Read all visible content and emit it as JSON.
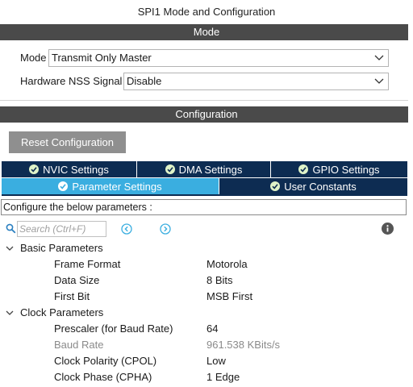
{
  "window": {
    "title": "SPI1 Mode and Configuration"
  },
  "mode_section": {
    "header": "Mode",
    "fields": [
      {
        "label": "Mode",
        "value": "Transmit Only Master"
      },
      {
        "label": "Hardware NSS Signal",
        "value": "Disable"
      }
    ]
  },
  "config_section": {
    "header": "Configuration",
    "reset_label": "Reset Configuration",
    "tabs_row1": [
      {
        "label": "NVIC Settings"
      },
      {
        "label": "DMA Settings"
      },
      {
        "label": "GPIO Settings"
      }
    ],
    "tabs_row2": [
      {
        "label": "Parameter Settings",
        "active": true
      },
      {
        "label": "User Constants",
        "active": false
      }
    ],
    "configure_text": "Configure the below parameters :",
    "search_placeholder": "Search (Ctrl+F)"
  },
  "params": {
    "groups": [
      {
        "name": "Basic Parameters",
        "items": [
          {
            "name": "Frame Format",
            "value": "Motorola"
          },
          {
            "name": "Data Size",
            "value": "8 Bits"
          },
          {
            "name": "First Bit",
            "value": "MSB First"
          }
        ]
      },
      {
        "name": "Clock Parameters",
        "items": [
          {
            "name": "Prescaler (for Baud Rate)",
            "value": "64"
          },
          {
            "name": "Baud Rate",
            "value": "961.538 KBits/s",
            "disabled": true
          },
          {
            "name": "Clock Polarity (CPOL)",
            "value": "Low"
          },
          {
            "name": "Clock Phase (CPHA)",
            "value": "1 Edge"
          }
        ]
      }
    ]
  },
  "colors": {
    "band": "#4a4a4a",
    "tab_dark": "#0d2c52",
    "tab_active": "#3aaee0",
    "reset_button": "#8f8f8f",
    "nav_arrow": "#3aaee0",
    "disabled_text": "#8a8a8a"
  },
  "icons": {
    "search": "search-icon",
    "prev": "arrow-left-circle-icon",
    "next": "arrow-right-circle-icon",
    "info": "info-icon",
    "check": "check-circle-icon",
    "expand": "chevron-down-icon"
  }
}
